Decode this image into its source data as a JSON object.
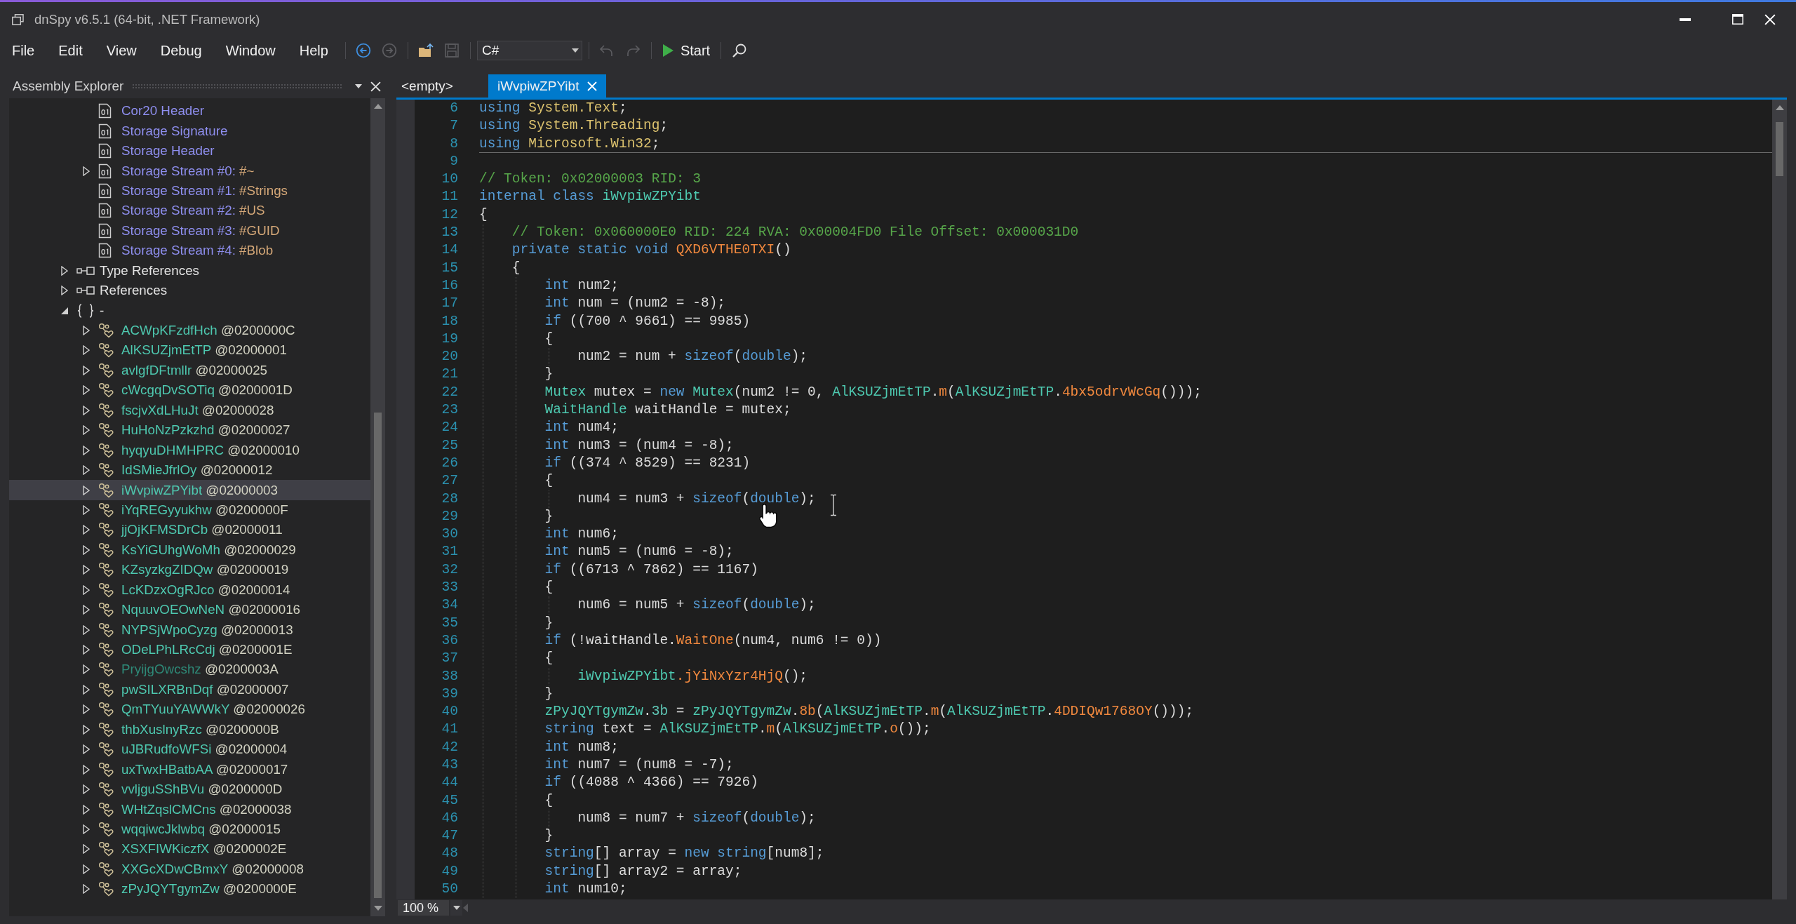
{
  "window": {
    "title": "dnSpy v6.5.1 (64-bit, .NET Framework)"
  },
  "menu": [
    "File",
    "Edit",
    "View",
    "Debug",
    "Window",
    "Help"
  ],
  "toolbar": {
    "items": [
      {
        "kind": "separator"
      },
      {
        "kind": "back",
        "disabled": false
      },
      {
        "kind": "forward",
        "disabled": true
      },
      {
        "kind": "separator"
      },
      {
        "kind": "open",
        "disabled": false
      },
      {
        "kind": "save",
        "disabled": true
      },
      {
        "kind": "separator"
      },
      {
        "kind": "language",
        "value": "C#",
        "disabled": false
      },
      {
        "kind": "separator"
      },
      {
        "kind": "undo",
        "disabled": true
      },
      {
        "kind": "redo",
        "disabled": true
      },
      {
        "kind": "separator"
      },
      {
        "kind": "start",
        "label": "Start",
        "disabled": false
      },
      {
        "kind": "separator"
      },
      {
        "kind": "search",
        "disabled": false
      }
    ]
  },
  "assembly_explorer": {
    "title": "Assembly Explorer",
    "items": [
      {
        "children": [
          {
            "kind": "metadata",
            "label": "Cor20 Header",
            "selected": false
          },
          {
            "kind": "metadata",
            "label": "Storage Signature",
            "selected": false
          },
          {
            "kind": "metadata",
            "label": "Storage Header",
            "selected": false
          },
          {
            "kind": "metadata",
            "label": "Storage Stream #0:",
            "suffix": "#~",
            "expanded": false,
            "selected": false
          },
          {
            "kind": "metadata",
            "label": "Storage Stream #1:",
            "suffix": "#Strings",
            "selected": false
          },
          {
            "kind": "metadata",
            "label": "Storage Stream #2:",
            "suffix": "#US",
            "selected": false
          },
          {
            "kind": "metadata",
            "label": "Storage Stream #3:",
            "suffix": "#GUID",
            "selected": false
          },
          {
            "kind": "metadata",
            "label": "Storage Stream #4:",
            "suffix": "#Blob",
            "selected": false
          }
        ]
      },
      {
        "kind": "references",
        "label": "Type References",
        "expanded": false,
        "selected": false
      },
      {
        "kind": "references",
        "label": "References",
        "expanded": false,
        "selected": false
      },
      {
        "kind": "namespace",
        "label": "-",
        "expanded": true,
        "selected": false,
        "children": [
          {
            "kind": "class",
            "label": "ACWpKFzdfHch",
            "suffix": "@0200000C",
            "expanded": false,
            "selected": false,
            "dimmed": false
          },
          {
            "kind": "class",
            "label": "AlKSUZjmEtTP",
            "suffix": "@02000001",
            "expanded": false,
            "selected": false,
            "dimmed": false
          },
          {
            "kind": "class",
            "label": "avlgfDFtmllr",
            "suffix": "@02000025",
            "expanded": false,
            "selected": false,
            "dimmed": false
          },
          {
            "kind": "class",
            "label": "cWcgqDvSOTiq",
            "suffix": "@0200001D",
            "expanded": false,
            "selected": false,
            "dimmed": false
          },
          {
            "kind": "class",
            "label": "fscjvXdLHuJt",
            "suffix": "@02000028",
            "expanded": false,
            "selected": false,
            "dimmed": false
          },
          {
            "kind": "class",
            "label": "HuHoNzPzkzhd",
            "suffix": "@02000027",
            "expanded": false,
            "selected": false,
            "dimmed": false
          },
          {
            "kind": "class",
            "label": "hyqyuDHMHPRC",
            "suffix": "@02000010",
            "expanded": false,
            "selected": false,
            "dimmed": false
          },
          {
            "kind": "class",
            "label": "IdSMieJfrlOy",
            "suffix": "@02000012",
            "expanded": false,
            "selected": false,
            "dimmed": false
          },
          {
            "kind": "class",
            "label": "iWvpiwZPYibt",
            "suffix": "@02000003",
            "expanded": false,
            "selected": true,
            "dimmed": false
          },
          {
            "kind": "class",
            "label": "iYqREGyyukhw",
            "suffix": "@0200000F",
            "expanded": false,
            "selected": false,
            "dimmed": false
          },
          {
            "kind": "class",
            "label": "jjOjKFMSDrCb",
            "suffix": "@02000011",
            "expanded": false,
            "selected": false,
            "dimmed": false
          },
          {
            "kind": "class",
            "label": "KsYiGUhgWoMh",
            "suffix": "@02000029",
            "expanded": false,
            "selected": false,
            "dimmed": false
          },
          {
            "kind": "class",
            "label": "KZsyzkgZIDQw",
            "suffix": "@02000019",
            "expanded": false,
            "selected": false,
            "dimmed": false
          },
          {
            "kind": "class",
            "label": "LcKDzxOgRJco",
            "suffix": "@02000014",
            "expanded": false,
            "selected": false,
            "dimmed": false
          },
          {
            "kind": "class",
            "label": "NquuvOEOwNeN",
            "suffix": "@02000016",
            "expanded": false,
            "selected": false,
            "dimmed": false
          },
          {
            "kind": "class",
            "label": "NYPSjWpoCyzg",
            "suffix": "@02000013",
            "expanded": false,
            "selected": false,
            "dimmed": false
          },
          {
            "kind": "class",
            "label": "ODeLPhLRcCdj",
            "suffix": "@0200001E",
            "expanded": false,
            "selected": false,
            "dimmed": false
          },
          {
            "kind": "class",
            "label": "PryijgOwcshz",
            "suffix": "@0200003A",
            "expanded": false,
            "selected": false,
            "dimmed": true
          },
          {
            "kind": "class",
            "label": "pwSILXRBnDqf",
            "suffix": "@02000007",
            "expanded": false,
            "selected": false,
            "dimmed": false
          },
          {
            "kind": "class",
            "label": "QmTYuuYAWWkY",
            "suffix": "@02000026",
            "expanded": false,
            "selected": false,
            "dimmed": false
          },
          {
            "kind": "class",
            "label": "thbXuslnyRzc",
            "suffix": "@0200000B",
            "expanded": false,
            "selected": false,
            "dimmed": false
          },
          {
            "kind": "class",
            "label": "uJBRudfoWFSi",
            "suffix": "@02000004",
            "expanded": false,
            "selected": false,
            "dimmed": false
          },
          {
            "kind": "class",
            "label": "uxTwxHBatbAA",
            "suffix": "@02000017",
            "expanded": false,
            "selected": false,
            "dimmed": false
          },
          {
            "kind": "class",
            "label": "vvljguSShBVu",
            "suffix": "@0200000D",
            "expanded": false,
            "selected": false,
            "dimmed": false
          },
          {
            "kind": "class",
            "label": "WHtZqslCMCns",
            "suffix": "@02000038",
            "expanded": false,
            "selected": false,
            "dimmed": false
          },
          {
            "kind": "class",
            "label": "wqqiwcJklwbq",
            "suffix": "@02000015",
            "expanded": false,
            "selected": false,
            "dimmed": false
          },
          {
            "kind": "class",
            "label": "XSXFIWKiczfX",
            "suffix": "@0200002E",
            "expanded": false,
            "selected": false,
            "dimmed": false
          },
          {
            "kind": "class",
            "label": "XXGcXDwCBmxY",
            "suffix": "@02000008",
            "expanded": false,
            "selected": false,
            "dimmed": false
          },
          {
            "kind": "class",
            "label": "zPyJQYTgymZw",
            "suffix": "@0200000E",
            "expanded": false,
            "selected": false,
            "dimmed": false
          }
        ]
      }
    ]
  },
  "editor": {
    "tabs": [
      {
        "label": "<empty>",
        "selected": false
      },
      {
        "label": "iWvpiwZPYibt",
        "selected": true
      }
    ],
    "code": {
      "sections": [
        {
          "lines": [
            {
              "number": "6",
              "tokens": [
                {
                  "kind": "keyword",
                  "text": "using "
                },
                {
                  "kind": "namespace",
                  "text": "System.Text"
                },
                {
                  "kind": "plain",
                  "text": ";"
                }
              ]
            },
            {
              "number": "7",
              "tokens": [
                {
                  "kind": "keyword",
                  "text": "using "
                },
                {
                  "kind": "namespace",
                  "text": "System.Threading"
                },
                {
                  "kind": "plain",
                  "text": ";"
                }
              ]
            },
            {
              "number": "8",
              "tokens": [
                {
                  "kind": "keyword",
                  "text": "using "
                },
                {
                  "kind": "namespace",
                  "text": "Microsoft.Win32"
                },
                {
                  "kind": "plain",
                  "text": ";"
                }
              ]
            }
          ]
        },
        {
          "lines": [
            {
              "number": "9"
            },
            {
              "number": "10",
              "tokens": [
                {
                  "kind": "comment",
                  "text": "// Token: 0x02000003 RID: 3"
                }
              ]
            },
            {
              "number": "11",
              "tokens": [
                {
                  "kind": "keyword",
                  "text": "internal class "
                },
                {
                  "kind": "type",
                  "text": "iWvpiwZPYibt"
                }
              ]
            },
            {
              "number": "12",
              "tokens": [
                {
                  "kind": "plain",
                  "text": "{"
                }
              ],
              "children": [
                {
                  "number": "13",
                  "tokens": [
                    {
                      "kind": "comment",
                      "text": "// Token: 0x060000E0 RID: 224 RVA: 0x00004FD0 File Offset: 0x000031D0"
                    }
                  ]
                },
                {
                  "number": "14",
                  "tokens": [
                    {
                      "kind": "keyword",
                      "text": "private static void "
                    },
                    {
                      "kind": "method",
                      "text": "QXD6VTHE0TXI"
                    },
                    {
                      "kind": "plain",
                      "text": "()"
                    }
                  ]
                },
                {
                  "number": "15",
                  "tokens": [
                    {
                      "kind": "plain",
                      "text": "{"
                    }
                  ],
                  "children": [
                    {
                      "number": "16",
                      "tokens": [
                        {
                          "kind": "keyword",
                          "text": "int"
                        },
                        {
                          "kind": "plain",
                          "text": " num2;"
                        }
                      ]
                    },
                    {
                      "number": "17",
                      "tokens": [
                        {
                          "kind": "keyword",
                          "text": "int"
                        },
                        {
                          "kind": "plain",
                          "text": " num = (num2 = -8);"
                        }
                      ]
                    },
                    {
                      "number": "18",
                      "tokens": [
                        {
                          "kind": "keyword",
                          "text": "if"
                        },
                        {
                          "kind": "plain",
                          "text": " ((700 ^ 9661) == 9985)"
                        }
                      ]
                    },
                    {
                      "number": "19",
                      "tokens": [
                        {
                          "kind": "plain",
                          "text": "{"
                        }
                      ],
                      "children": [
                        {
                          "number": "20",
                          "tokens": [
                            {
                              "kind": "plain",
                              "text": "num2 = num + "
                            },
                            {
                              "kind": "keyword",
                              "text": "sizeof"
                            },
                            {
                              "kind": "plain",
                              "text": "("
                            },
                            {
                              "kind": "keyword",
                              "text": "double"
                            },
                            {
                              "kind": "plain",
                              "text": ");"
                            }
                          ]
                        }
                      ]
                    },
                    {
                      "number": "21",
                      "tokens": [
                        {
                          "kind": "plain",
                          "text": "}"
                        }
                      ]
                    },
                    {
                      "number": "22",
                      "tokens": [
                        {
                          "kind": "type",
                          "text": "Mutex"
                        },
                        {
                          "kind": "plain",
                          "text": " mutex = "
                        },
                        {
                          "kind": "keyword",
                          "text": "new "
                        },
                        {
                          "kind": "type",
                          "text": "Mutex"
                        },
                        {
                          "kind": "plain",
                          "text": "(num2 != 0, "
                        },
                        {
                          "kind": "type",
                          "text": "AlKSUZjmEtTP"
                        },
                        {
                          "kind": "plain",
                          "text": "."
                        },
                        {
                          "kind": "method",
                          "text": "m"
                        },
                        {
                          "kind": "plain",
                          "text": "("
                        },
                        {
                          "kind": "type",
                          "text": "AlKSUZjmEtTP"
                        },
                        {
                          "kind": "plain",
                          "text": "."
                        },
                        {
                          "kind": "method",
                          "text": "4bx5odrvWcGq"
                        },
                        {
                          "kind": "plain",
                          "text": "()));"
                        }
                      ]
                    },
                    {
                      "number": "23",
                      "tokens": [
                        {
                          "kind": "type",
                          "text": "WaitHandle"
                        },
                        {
                          "kind": "plain",
                          "text": " waitHandle = mutex;"
                        }
                      ]
                    },
                    {
                      "number": "24",
                      "tokens": [
                        {
                          "kind": "keyword",
                          "text": "int"
                        },
                        {
                          "kind": "plain",
                          "text": " num4;"
                        }
                      ]
                    },
                    {
                      "number": "25",
                      "tokens": [
                        {
                          "kind": "keyword",
                          "text": "int"
                        },
                        {
                          "kind": "plain",
                          "text": " num3 = (num4 = -8);"
                        }
                      ]
                    },
                    {
                      "number": "26",
                      "tokens": [
                        {
                          "kind": "keyword",
                          "text": "if"
                        },
                        {
                          "kind": "plain",
                          "text": " ((374 ^ 8529) == 8231)"
                        }
                      ]
                    },
                    {
                      "number": "27",
                      "tokens": [
                        {
                          "kind": "plain",
                          "text": "{"
                        }
                      ],
                      "children": [
                        {
                          "number": "28",
                          "tokens": [
                            {
                              "kind": "plain",
                              "text": "num4 = num3 + "
                            },
                            {
                              "kind": "keyword",
                              "text": "sizeof"
                            },
                            {
                              "kind": "plain",
                              "text": "("
                            },
                            {
                              "kind": "keyword",
                              "text": "double"
                            },
                            {
                              "kind": "plain",
                              "text": ");"
                            }
                          ]
                        }
                      ]
                    },
                    {
                      "number": "29",
                      "tokens": [
                        {
                          "kind": "plain",
                          "text": "}"
                        }
                      ]
                    },
                    {
                      "number": "30",
                      "tokens": [
                        {
                          "kind": "keyword",
                          "text": "int"
                        },
                        {
                          "kind": "plain",
                          "text": " num6;"
                        }
                      ]
                    },
                    {
                      "number": "31",
                      "tokens": [
                        {
                          "kind": "keyword",
                          "text": "int"
                        },
                        {
                          "kind": "plain",
                          "text": " num5 = (num6 = -8);"
                        }
                      ]
                    },
                    {
                      "number": "32",
                      "tokens": [
                        {
                          "kind": "keyword",
                          "text": "if"
                        },
                        {
                          "kind": "plain",
                          "text": " ((6713 ^ 7862) == 1167)"
                        }
                      ]
                    },
                    {
                      "number": "33",
                      "tokens": [
                        {
                          "kind": "plain",
                          "text": "{"
                        }
                      ],
                      "children": [
                        {
                          "number": "34",
                          "tokens": [
                            {
                              "kind": "plain",
                              "text": "num6 = num5 + "
                            },
                            {
                              "kind": "keyword",
                              "text": "sizeof"
                            },
                            {
                              "kind": "plain",
                              "text": "("
                            },
                            {
                              "kind": "keyword",
                              "text": "double"
                            },
                            {
                              "kind": "plain",
                              "text": ");"
                            }
                          ]
                        }
                      ]
                    },
                    {
                      "number": "35",
                      "tokens": [
                        {
                          "kind": "plain",
                          "text": "}"
                        }
                      ]
                    },
                    {
                      "number": "36",
                      "tokens": [
                        {
                          "kind": "keyword",
                          "text": "if"
                        },
                        {
                          "kind": "plain",
                          "text": " (!waitHandle."
                        },
                        {
                          "kind": "method",
                          "text": "WaitOne"
                        },
                        {
                          "kind": "plain",
                          "text": "(num4, num6 != 0))"
                        }
                      ]
                    },
                    {
                      "number": "37",
                      "tokens": [
                        {
                          "kind": "plain",
                          "text": "{"
                        }
                      ],
                      "children": [
                        {
                          "number": "38",
                          "tokens": [
                            {
                              "kind": "type",
                              "text": "iWvpiwZPYibt"
                            },
                            {
                              "kind": "method",
                              "text": ".jYiNxYzr4HjQ"
                            },
                            {
                              "kind": "plain",
                              "text": "();"
                            }
                          ]
                        }
                      ]
                    },
                    {
                      "number": "39",
                      "tokens": [
                        {
                          "kind": "plain",
                          "text": "}"
                        }
                      ]
                    },
                    {
                      "number": "40",
                      "tokens": [
                        {
                          "kind": "type",
                          "text": "zPyJQYTgymZw"
                        },
                        {
                          "kind": "plain",
                          "text": "."
                        },
                        {
                          "kind": "field",
                          "text": "3b"
                        },
                        {
                          "kind": "plain",
                          "text": " = "
                        },
                        {
                          "kind": "type",
                          "text": "zPyJQYTgymZw"
                        },
                        {
                          "kind": "plain",
                          "text": "."
                        },
                        {
                          "kind": "method",
                          "text": "8b"
                        },
                        {
                          "kind": "plain",
                          "text": "("
                        },
                        {
                          "kind": "type",
                          "text": "AlKSUZjmEtTP"
                        },
                        {
                          "kind": "plain",
                          "text": "."
                        },
                        {
                          "kind": "method",
                          "text": "m"
                        },
                        {
                          "kind": "plain",
                          "text": "("
                        },
                        {
                          "kind": "type",
                          "text": "AlKSUZjmEtTP"
                        },
                        {
                          "kind": "plain",
                          "text": "."
                        },
                        {
                          "kind": "method",
                          "text": "4DDIQw1768OY"
                        },
                        {
                          "kind": "plain",
                          "text": "()));"
                        }
                      ]
                    },
                    {
                      "number": "41",
                      "tokens": [
                        {
                          "kind": "keyword",
                          "text": "string"
                        },
                        {
                          "kind": "plain",
                          "text": " text = "
                        },
                        {
                          "kind": "type",
                          "text": "AlKSUZjmEtTP"
                        },
                        {
                          "kind": "plain",
                          "text": "."
                        },
                        {
                          "kind": "method",
                          "text": "m"
                        },
                        {
                          "kind": "plain",
                          "text": "("
                        },
                        {
                          "kind": "type",
                          "text": "AlKSUZjmEtTP"
                        },
                        {
                          "kind": "plain",
                          "text": "."
                        },
                        {
                          "kind": "method",
                          "text": "o"
                        },
                        {
                          "kind": "plain",
                          "text": "());"
                        }
                      ]
                    },
                    {
                      "number": "42",
                      "tokens": [
                        {
                          "kind": "keyword",
                          "text": "int"
                        },
                        {
                          "kind": "plain",
                          "text": " num8;"
                        }
                      ]
                    },
                    {
                      "number": "43",
                      "tokens": [
                        {
                          "kind": "keyword",
                          "text": "int"
                        },
                        {
                          "kind": "plain",
                          "text": " num7 = (num8 = -7);"
                        }
                      ]
                    },
                    {
                      "number": "44",
                      "tokens": [
                        {
                          "kind": "keyword",
                          "text": "if"
                        },
                        {
                          "kind": "plain",
                          "text": " ((4088 ^ 4366) == 7926)"
                        }
                      ]
                    },
                    {
                      "number": "45",
                      "tokens": [
                        {
                          "kind": "plain",
                          "text": "{"
                        }
                      ],
                      "children": [
                        {
                          "number": "46",
                          "tokens": [
                            {
                              "kind": "plain",
                              "text": "num8 = num7 + "
                            },
                            {
                              "kind": "keyword",
                              "text": "sizeof"
                            },
                            {
                              "kind": "plain",
                              "text": "("
                            },
                            {
                              "kind": "keyword",
                              "text": "double"
                            },
                            {
                              "kind": "plain",
                              "text": ");"
                            }
                          ]
                        }
                      ]
                    },
                    {
                      "number": "47",
                      "tokens": [
                        {
                          "kind": "plain",
                          "text": "}"
                        }
                      ]
                    },
                    {
                      "number": "48",
                      "tokens": [
                        {
                          "kind": "keyword",
                          "text": "string"
                        },
                        {
                          "kind": "plain",
                          "text": "[] array = "
                        },
                        {
                          "kind": "keyword",
                          "text": "new string"
                        },
                        {
                          "kind": "plain",
                          "text": "[num8];"
                        }
                      ]
                    },
                    {
                      "number": "49",
                      "tokens": [
                        {
                          "kind": "keyword",
                          "text": "string"
                        },
                        {
                          "kind": "plain",
                          "text": "[] array2 = array;"
                        }
                      ]
                    },
                    {
                      "number": "50",
                      "tokens": [
                        {
                          "kind": "keyword",
                          "text": "int"
                        },
                        {
                          "kind": "plain",
                          "text": " num10;"
                        }
                      ]
                    }
                  ]
                }
              ]
            }
          ]
        }
      ]
    },
    "zoom": "100 %"
  }
}
